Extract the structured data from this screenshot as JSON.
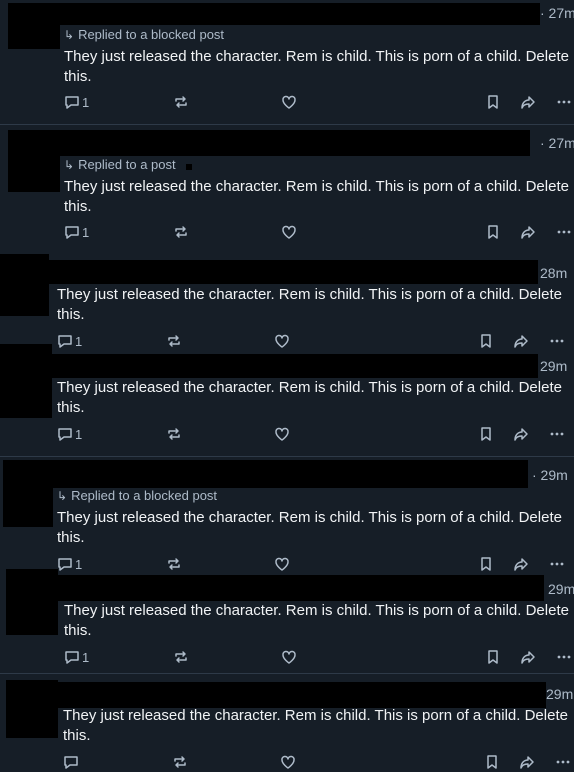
{
  "posts": [
    {
      "time": "· 27m",
      "reply": "Replied to a blocked post",
      "text": "They just released the character. Rem is child. This is porn of a child. Delete this.",
      "replies": "1"
    },
    {
      "time": "· 27m",
      "reply": "Replied to a post",
      "text": "They just released the character. Rem is child. This is porn of a child. Delete this.",
      "replies": "1"
    },
    {
      "time": "28m",
      "reply": "",
      "text": "They just released the character. Rem is child. This is porn of a child. Delete this.",
      "replies": "1"
    },
    {
      "time": "29m",
      "reply": "",
      "text": "They just released the character. Rem is child. This is porn of a child. Delete this.",
      "replies": "1"
    },
    {
      "time": "· 29m",
      "reply": "Replied to a blocked post",
      "text": "They just released the character. Rem is child. This is porn of a child. Delete this.",
      "replies": "1"
    },
    {
      "time": "29m",
      "reply": "",
      "text": "They just released the character. Rem is child. This is porn of a child. Delete this.",
      "replies": "1"
    },
    {
      "time": "29m",
      "reply": "",
      "text": "They just released the character. Rem is child. This is porn of a child. Delete this.",
      "replies": ""
    }
  ],
  "icons": {
    "reply": "reply-icon",
    "repost": "repost-icon",
    "like": "heart-icon",
    "bookmark": "bookmark-icon",
    "share": "share-icon",
    "more": "more-icon"
  },
  "colors": {
    "background": "#161e27",
    "text": "#f1f3f5",
    "muted": "#aebbc9",
    "divider": "#2e3a48",
    "redaction": "#000000"
  }
}
